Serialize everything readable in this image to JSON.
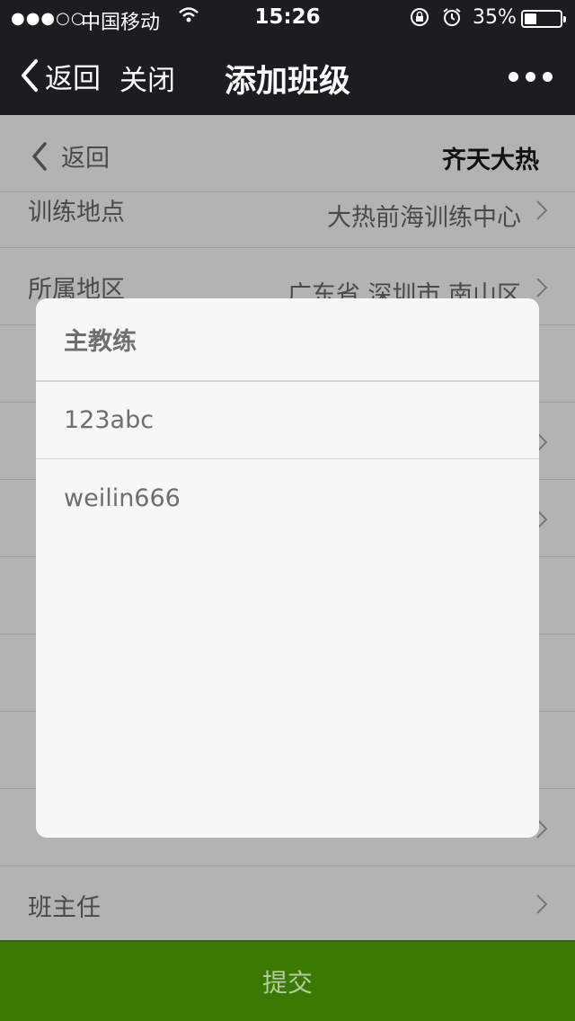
{
  "status_bar": {
    "signal": "●●●○○",
    "carrier": "中国移动",
    "time": "15:26",
    "battery_percent": "35%",
    "battery_level": 0.35
  },
  "nav": {
    "back_label": "返回",
    "close_label": "关闭",
    "title": "添加班级",
    "more_icon": "more-horizontal-icon"
  },
  "subheader": {
    "back_label": "返回",
    "org_name": "齐天大热"
  },
  "form_rows": [
    {
      "label": "训练地点",
      "value": "大热前海训练中心"
    },
    {
      "label": "所属地区",
      "value": "广东省 深圳市 南山区"
    },
    {
      "label": "",
      "value": ""
    },
    {
      "label": "",
      "value": ""
    },
    {
      "label": "",
      "value": ""
    },
    {
      "label": "",
      "value": ""
    },
    {
      "label": "",
      "value": ""
    },
    {
      "label": "",
      "value": ""
    },
    {
      "label": "",
      "value": ""
    },
    {
      "label": "班主任",
      "value": ""
    }
  ],
  "submit_label": "提交",
  "modal": {
    "title": "主教练",
    "options": [
      "123abc",
      "weilin666"
    ]
  },
  "colors": {
    "nav_bg": "#1c1c21",
    "submit_bg": "#3b7a00",
    "overlay": "#b3b3b3",
    "modal_bg": "#f7f7f7"
  }
}
